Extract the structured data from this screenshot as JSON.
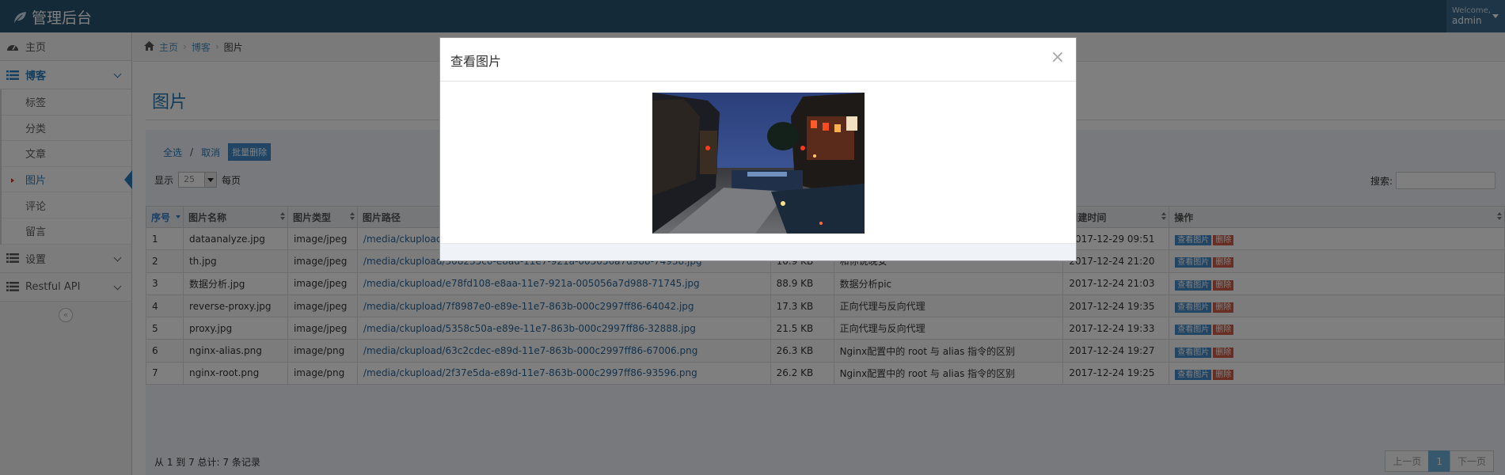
{
  "app": {
    "title": "管理后台",
    "welcome": "Welcome,",
    "user": "admin"
  },
  "sidebar": {
    "home": "主页",
    "blog": "博客",
    "blog_items": [
      {
        "label": "标签"
      },
      {
        "label": "分类"
      },
      {
        "label": "文章"
      },
      {
        "label": "图片"
      },
      {
        "label": "评论"
      },
      {
        "label": "留言"
      }
    ],
    "settings": "设置",
    "restful": "Restful API",
    "collapse_glyph": "«"
  },
  "breadcrumb": {
    "home": "主页",
    "blog": "博客",
    "current": "图片"
  },
  "page": {
    "title": "图片"
  },
  "toolbar": {
    "select_all": "全选",
    "slash": "/",
    "cancel": "取消",
    "batch_delete": "批量删除"
  },
  "length": {
    "show": "显示",
    "value": "25",
    "per_page": "每页"
  },
  "search": {
    "label": "搜索:",
    "value": ""
  },
  "table": {
    "headers": [
      "序号",
      "图片名称",
      "图片类型",
      "图片路径",
      "",
      "",
      "创建时间",
      "操作"
    ],
    "rows": [
      {
        "no": "1",
        "name": "dataanalyze.jpg",
        "type": "image/jpeg",
        "path": "/media/ckupload/",
        "size": "",
        "desc": "",
        "time": "2017-12-29 09:51"
      },
      {
        "no": "2",
        "name": "th.jpg",
        "type": "image/jpeg",
        "path": "/media/ckupload/308235c0-e8ad-11e7-921a-005056a7d988-74938.jpg",
        "size": "10.9 KB",
        "desc": "和你说晚安",
        "time": "2017-12-24 21:20"
      },
      {
        "no": "3",
        "name": "数据分析.jpg",
        "type": "image/jpeg",
        "path": "/media/ckupload/e78fd108-e8aa-11e7-921a-005056a7d988-71745.jpg",
        "size": "88.9 KB",
        "desc": "数据分析pic",
        "time": "2017-12-24 21:03"
      },
      {
        "no": "4",
        "name": "reverse-proxy.jpg",
        "type": "image/jpeg",
        "path": "/media/ckupload/7f8987e0-e89e-11e7-863b-000c2997ff86-64042.jpg",
        "size": "17.3 KB",
        "desc": "正向代理与反向代理",
        "time": "2017-12-24 19:35"
      },
      {
        "no": "5",
        "name": "proxy.jpg",
        "type": "image/jpeg",
        "path": "/media/ckupload/5358c50a-e89e-11e7-863b-000c2997ff86-32888.jpg",
        "size": "21.5 KB",
        "desc": "正向代理与反向代理",
        "time": "2017-12-24 19:33"
      },
      {
        "no": "6",
        "name": "nginx-alias.png",
        "type": "image/png",
        "path": "/media/ckupload/63c2cdec-e89d-11e7-863b-000c2997ff86-67006.png",
        "size": "26.3 KB",
        "desc": "Nginx配置中的 root 与 alias 指令的区别",
        "time": "2017-12-24 19:27"
      },
      {
        "no": "7",
        "name": "nginx-root.png",
        "type": "image/png",
        "path": "/media/ckupload/2f37e5da-e89d-11e7-863b-000c2997ff86-93596.png",
        "size": "26.2 KB",
        "desc": "Nginx配置中的 root 与 alias 指令的区别",
        "time": "2017-12-24 19:25"
      }
    ],
    "view_label": "查看图片",
    "delete_label": "删除"
  },
  "footer": {
    "info": "从 1 到 7 总计: 7 条记录",
    "prev": "上一页",
    "page": "1",
    "next": "下一页"
  },
  "modal": {
    "title": "查看图片",
    "close": "×"
  },
  "colors": {
    "navbar": "#2b5472",
    "accent": "#2b7dbc",
    "button_blue": "#428bca",
    "button_red": "#d15b47"
  }
}
